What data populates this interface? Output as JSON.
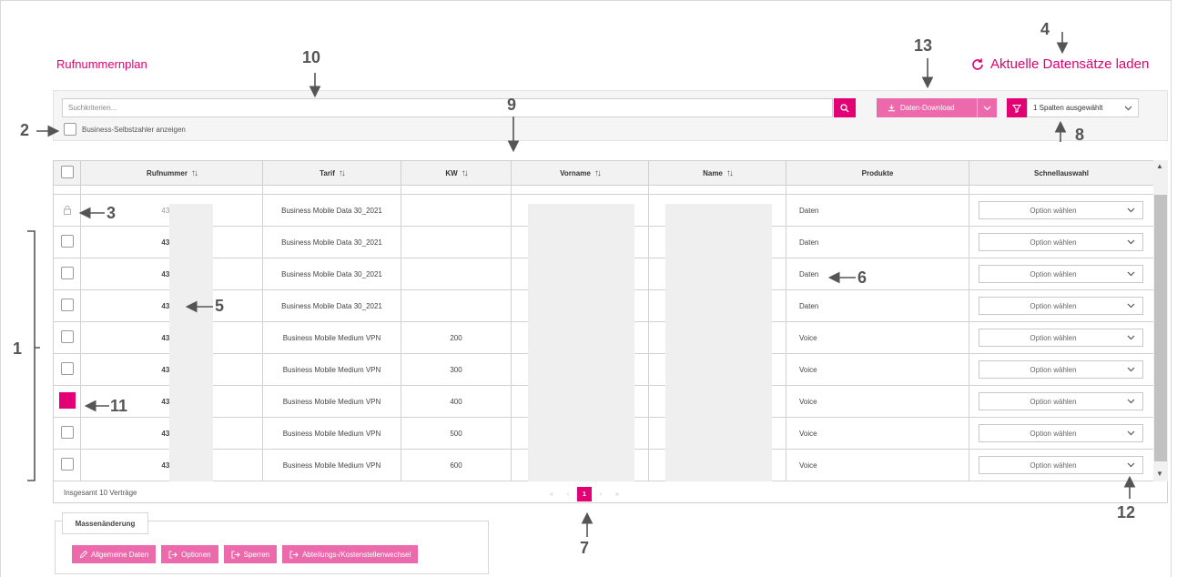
{
  "page": {
    "title": "Rufnummernplan",
    "reload_label": "Aktuelle Datensätze laden"
  },
  "search": {
    "placeholder": "Suchkriterien...",
    "download_label": "Daten-Download",
    "columns_selected": "1 Spalten ausgewählt",
    "business_checkbox_label": "Business-Selbstzahler anzeigen"
  },
  "table": {
    "headers": [
      "Rufnummer",
      "Tarif",
      "KW",
      "Vorname",
      "Name",
      "Produkte",
      "Schnellauswahl"
    ],
    "select_placeholder": "Option wählen",
    "rows": [
      {
        "number": "43676",
        "tarif": "Business Mobile Data 30_2021",
        "kw": "",
        "product": "Daten",
        "state": "locked"
      },
      {
        "number": "43676",
        "tarif": "Business Mobile Data 30_2021",
        "kw": "",
        "product": "Daten",
        "state": "unchecked"
      },
      {
        "number": "43676",
        "tarif": "Business Mobile Data 30_2021",
        "kw": "",
        "product": "Daten",
        "state": "unchecked"
      },
      {
        "number": "43676",
        "tarif": "Business Mobile Data 30_2021",
        "kw": "",
        "product": "Daten",
        "state": "unchecked"
      },
      {
        "number": "43676",
        "tarif": "Business Mobile Medium VPN",
        "kw": "200",
        "product": "Voice",
        "state": "unchecked"
      },
      {
        "number": "43676",
        "tarif": "Business Mobile Medium VPN",
        "kw": "300",
        "product": "Voice",
        "state": "unchecked"
      },
      {
        "number": "43676",
        "tarif": "Business Mobile Medium VPN",
        "kw": "400",
        "product": "Voice",
        "state": "checked"
      },
      {
        "number": "43676",
        "tarif": "Business Mobile Medium VPN",
        "kw": "500",
        "product": "Voice",
        "state": "unchecked"
      },
      {
        "number": "43650",
        "tarif": "Business Mobile Medium VPN",
        "kw": "600",
        "product": "Voice",
        "state": "unchecked"
      }
    ],
    "summary": "Insgesamt 10 Verträge"
  },
  "pagination": {
    "first": "«",
    "prev": "‹",
    "current": "1",
    "next": "›",
    "last": "»"
  },
  "mass_change": {
    "tab_label": "Massenänderung",
    "buttons": [
      "Allgemeine Daten",
      "Optionen",
      "Sperren",
      "Abteilungs-/Kostenstellenwechsel"
    ]
  },
  "annotations": {
    "a1": "1",
    "a2": "2",
    "a3": "3",
    "a4": "4",
    "a5": "5",
    "a6": "6",
    "a7": "7",
    "a8": "8",
    "a9": "9",
    "a10": "10",
    "a11": "11",
    "a12": "12",
    "a13": "13"
  },
  "colors": {
    "brand": "#e20074",
    "brand_light": "#ec6aac"
  }
}
